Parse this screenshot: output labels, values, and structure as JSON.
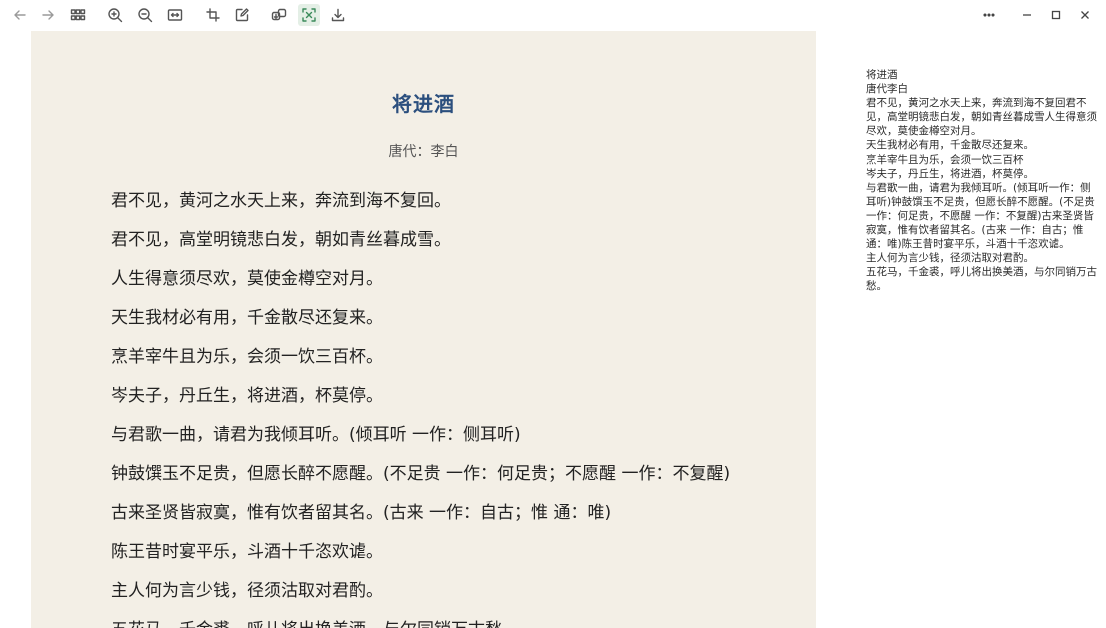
{
  "toolbar": {
    "left_icons": [
      {
        "name": "back-arrow-icon",
        "glyph": "back"
      },
      {
        "name": "forward-arrow-icon",
        "glyph": "forward"
      },
      {
        "name": "grid-view-icon",
        "glyph": "grid"
      },
      {
        "name": "zoom-in-icon",
        "glyph": "zoom-in"
      },
      {
        "name": "zoom-out-icon",
        "glyph": "zoom-out"
      },
      {
        "name": "fit-page-icon",
        "glyph": "fit"
      },
      {
        "name": "rotate-icon",
        "glyph": "rotate"
      },
      {
        "name": "edit-icon",
        "glyph": "edit"
      },
      {
        "name": "translate-icon",
        "glyph": "translate"
      },
      {
        "name": "text-recognition-icon",
        "glyph": "ocr",
        "active": true
      },
      {
        "name": "download-icon",
        "glyph": "download"
      }
    ],
    "right_icons": [
      {
        "name": "more-options-icon"
      },
      {
        "name": "minimize-icon"
      },
      {
        "name": "maximize-icon"
      },
      {
        "name": "close-icon"
      }
    ]
  },
  "poem": {
    "title": "将进酒",
    "author": "唐代：李白",
    "lines": [
      "君不见，黄河之水天上来，奔流到海不复回。",
      "君不见，高堂明镜悲白发，朝如青丝暮成雪。",
      "人生得意须尽欢，莫使金樽空对月。",
      "天生我材必有用，千金散尽还复来。",
      "烹羊宰牛且为乐，会须一饮三百杯。",
      "岑夫子，丹丘生，将进酒，杯莫停。",
      "与君歌一曲，请君为我倾耳听。(倾耳听 一作：侧耳听)",
      "钟鼓馔玉不足贵，但愿长醉不愿醒。(不足贵 一作：何足贵；不愿醒 一作：不复醒)",
      "古来圣贤皆寂寞，惟有饮者留其名。(古来 一作：自古；惟 通：唯)",
      "陈王昔时宴平乐，斗酒十千恣欢谑。",
      "主人何为言少钱，径须沽取对君酌。",
      "五花马，千金裘，呼儿将出换美酒，与尔同销万古愁。"
    ]
  },
  "recognized_text": {
    "lines": [
      "将进酒",
      "唐代李白",
      "君不见，黄河之水天上来，奔流到海不复回君不见，高堂明镜悲白发，朝如青丝暮成雪人生得意须尽欢，莫使金樽空对月。",
      "天生我材必有用，千金散尽还复来。",
      "烹羊宰牛且为乐，会须一饮三百杯",
      "岑夫子，丹丘生，将进酒，杯莫停。",
      "与君歌一曲，请君为我倾耳听。(倾耳听一作：侧耳听)钟鼓馔玉不足贵，但愿长醉不愿醒。(不足贵 一作：何足贵，不愿醒 一作：不复醒)古来圣贤皆寂寞，惟有饮者留其名。(古来 一作：自古；惟 通：唯)陈王昔时宴平乐，斗酒十千恣欢谑。",
      "主人何为言少钱，径须沽取对君酌。",
      "五花马，千金裘，呼儿将出换美酒，与尔同销万古愁。"
    ]
  }
}
